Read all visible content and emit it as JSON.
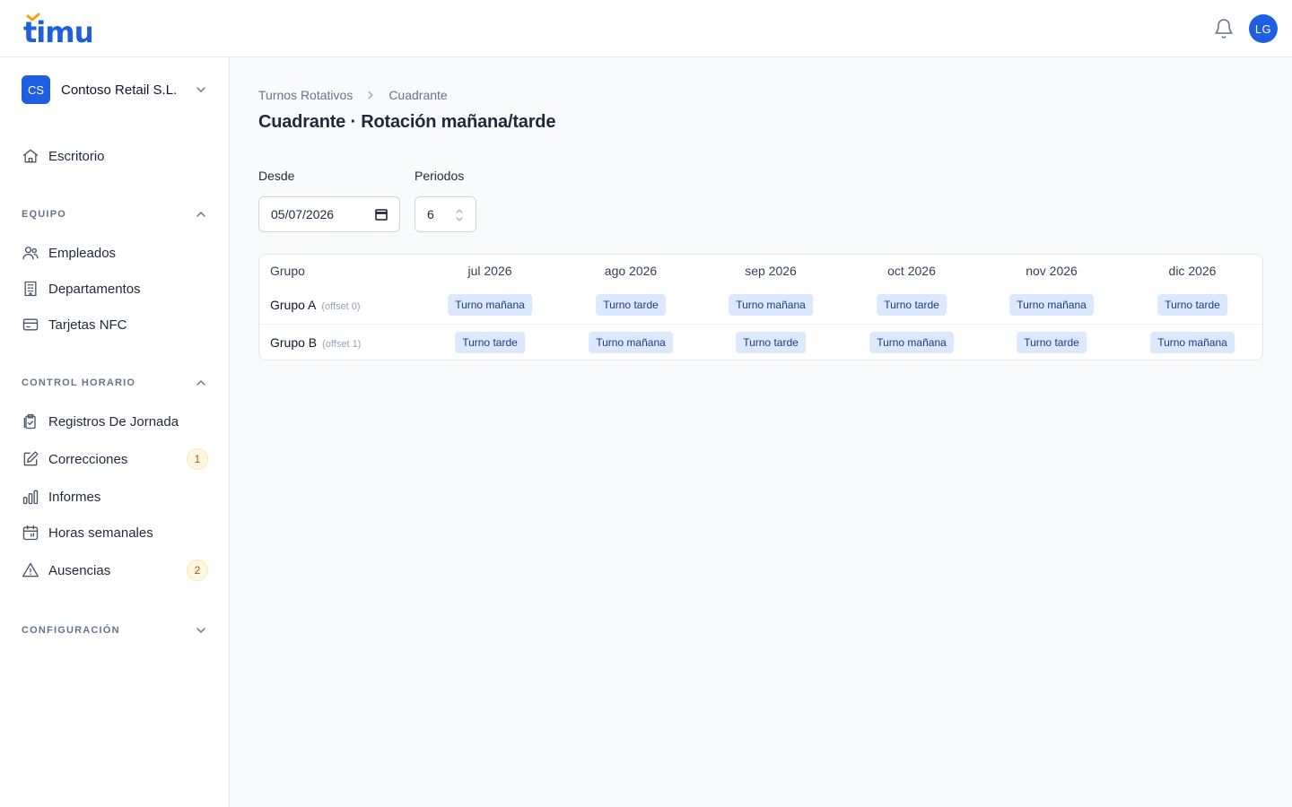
{
  "app": {
    "logo_text": "timu",
    "avatar_initials": "LG"
  },
  "org": {
    "initials": "CS",
    "name": "Contoso Retail S.L."
  },
  "nav": {
    "home": "Escritorio",
    "equipo": {
      "title": "EQUIPO",
      "items": [
        "Empleados",
        "Departamentos",
        "Tarjetas NFC"
      ]
    },
    "control": {
      "title": "CONTROL HORARIO",
      "items": [
        {
          "label": "Registros De Jornada",
          "badge": ""
        },
        {
          "label": "Correcciones",
          "badge": "1"
        },
        {
          "label": "Informes",
          "badge": ""
        },
        {
          "label": "Horas semanales",
          "badge": ""
        },
        {
          "label": "Ausencias",
          "badge": "2"
        }
      ]
    },
    "config": {
      "title": "CONFIGURACIÓN"
    }
  },
  "breadcrumb": [
    "Turnos Rotativos",
    "Cuadrante"
  ],
  "page_title": "Cuadrante · Rotación mañana/tarde",
  "filters": {
    "desde_label": "Desde",
    "desde_value": "05/07/2026",
    "periodos_label": "Periodos",
    "periodos_value": "6"
  },
  "table": {
    "group_header": "Grupo",
    "months": [
      "jul 2026",
      "ago 2026",
      "sep 2026",
      "oct 2026",
      "nov 2026",
      "dic 2026"
    ],
    "rows": [
      {
        "name": "Grupo A",
        "offset": "(offset 0)",
        "shifts": [
          "Turno mañana",
          "Turno tarde",
          "Turno mañana",
          "Turno tarde",
          "Turno mañana",
          "Turno tarde"
        ]
      },
      {
        "name": "Grupo B",
        "offset": "(offset 1)",
        "shifts": [
          "Turno tarde",
          "Turno mañana",
          "Turno tarde",
          "Turno mañana",
          "Turno tarde",
          "Turno mañana"
        ]
      }
    ]
  },
  "colors": {
    "brand": "#1d5fe0",
    "chip_bg": "#dbe8fd",
    "chip_text": "#1e3a8a",
    "badge_bg": "#fef6e0"
  }
}
